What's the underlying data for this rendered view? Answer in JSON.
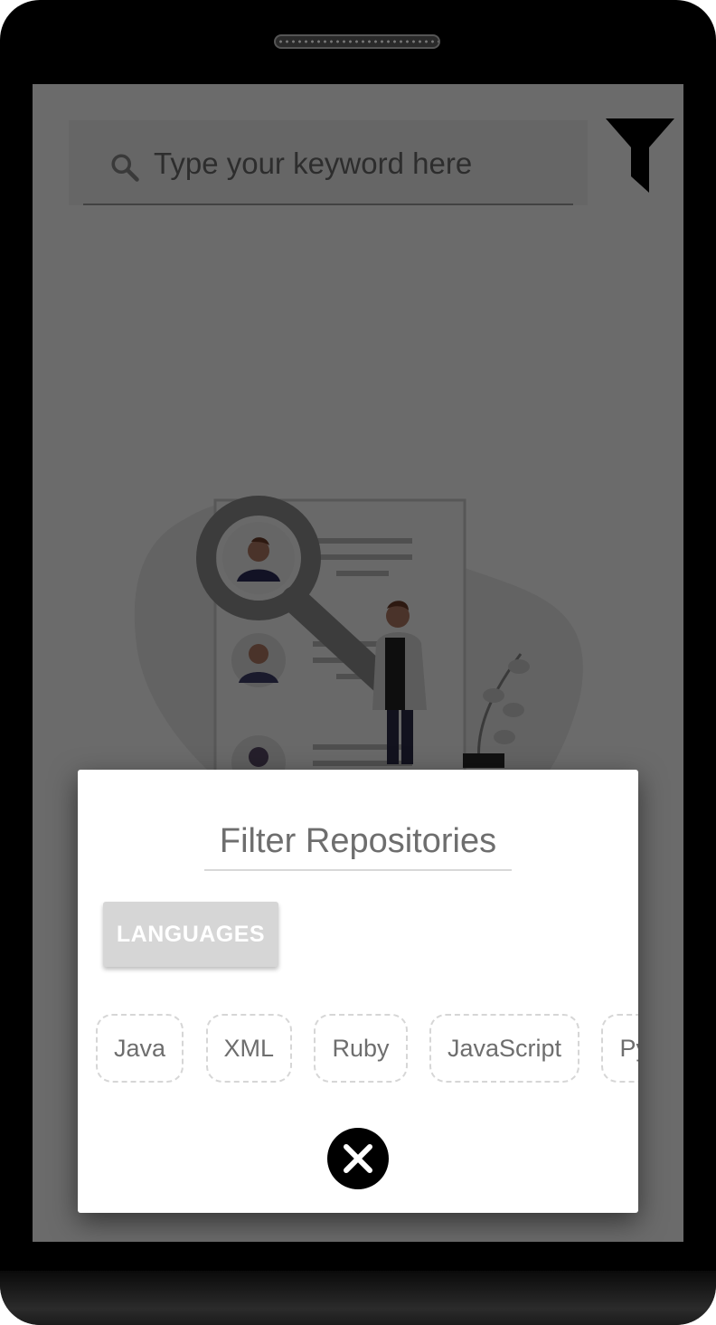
{
  "search": {
    "placeholder": "Type your keyword here",
    "icon": "search-icon"
  },
  "header": {
    "filter_icon": "filter-icon"
  },
  "dialog": {
    "title": "Filter Repositories",
    "languages_button": "LANGUAGES",
    "chips": [
      {
        "label": "Java"
      },
      {
        "label": "XML"
      },
      {
        "label": "Ruby"
      },
      {
        "label": "JavaScript"
      },
      {
        "label": "Python"
      }
    ],
    "close_icon": "close-icon"
  },
  "colors": {
    "overlay": "#000000",
    "dialog_bg": "#ffffff",
    "chip_border": "#d6d6d6",
    "button_bg": "#d6d6d6"
  }
}
